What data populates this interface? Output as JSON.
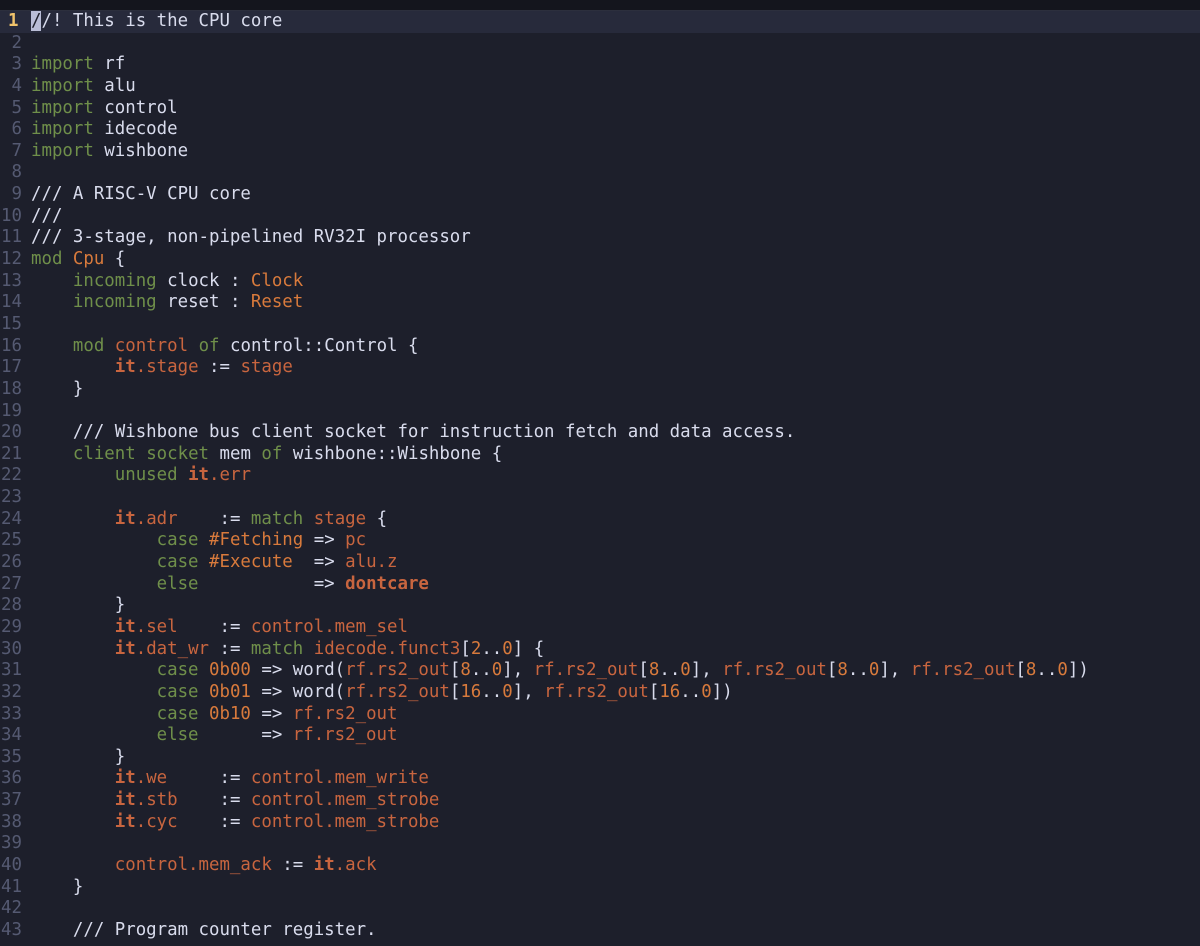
{
  "editor": {
    "current_line": 1,
    "lines": [
      [
        [
          "comment",
          "//! This is the CPU core"
        ]
      ],
      [],
      [
        [
          "keyword",
          "import"
        ],
        [
          "plain",
          " rf"
        ]
      ],
      [
        [
          "keyword",
          "import"
        ],
        [
          "plain",
          " alu"
        ]
      ],
      [
        [
          "keyword",
          "import"
        ],
        [
          "plain",
          " control"
        ]
      ],
      [
        [
          "keyword",
          "import"
        ],
        [
          "plain",
          " idecode"
        ]
      ],
      [
        [
          "keyword",
          "import"
        ],
        [
          "plain",
          " wishbone"
        ]
      ],
      [],
      [
        [
          "comment",
          "/// A RISC-V CPU core"
        ]
      ],
      [
        [
          "comment",
          "///"
        ]
      ],
      [
        [
          "comment",
          "/// 3-stage, non-pipelined RV32I processor"
        ]
      ],
      [
        [
          "keyword",
          "mod"
        ],
        [
          "plain",
          " "
        ],
        [
          "type",
          "Cpu"
        ],
        [
          "plain",
          " {"
        ]
      ],
      [
        [
          "plain",
          "    "
        ],
        [
          "keyword",
          "incoming"
        ],
        [
          "plain",
          " clock : "
        ],
        [
          "type",
          "Clock"
        ]
      ],
      [
        [
          "plain",
          "    "
        ],
        [
          "keyword",
          "incoming"
        ],
        [
          "plain",
          " reset : "
        ],
        [
          "type",
          "Reset"
        ]
      ],
      [],
      [
        [
          "plain",
          "    "
        ],
        [
          "keyword",
          "mod"
        ],
        [
          "plain",
          " "
        ],
        [
          "ident",
          "control"
        ],
        [
          "plain",
          " "
        ],
        [
          "keyword",
          "of"
        ],
        [
          "plain",
          " control::Control {"
        ]
      ],
      [
        [
          "plain",
          "        "
        ],
        [
          "bold",
          "it"
        ],
        [
          "ident",
          ".stage"
        ],
        [
          "plain",
          " := "
        ],
        [
          "ident",
          "stage"
        ]
      ],
      [
        [
          "plain",
          "    }"
        ]
      ],
      [],
      [
        [
          "plain",
          "    "
        ],
        [
          "comment",
          "/// Wishbone bus client socket for instruction fetch and data access."
        ]
      ],
      [
        [
          "plain",
          "    "
        ],
        [
          "keyword",
          "client"
        ],
        [
          "plain",
          " "
        ],
        [
          "keyword",
          "socket"
        ],
        [
          "plain",
          " mem "
        ],
        [
          "keyword",
          "of"
        ],
        [
          "plain",
          " wishbone::Wishbone {"
        ]
      ],
      [
        [
          "plain",
          "        "
        ],
        [
          "keyword",
          "unused"
        ],
        [
          "plain",
          " "
        ],
        [
          "bold",
          "it"
        ],
        [
          "ident",
          ".err"
        ]
      ],
      [],
      [
        [
          "plain",
          "        "
        ],
        [
          "bold",
          "it"
        ],
        [
          "ident",
          ".adr"
        ],
        [
          "plain",
          "    := "
        ],
        [
          "keyword",
          "match"
        ],
        [
          "plain",
          " "
        ],
        [
          "ident",
          "stage"
        ],
        [
          "plain",
          " {"
        ]
      ],
      [
        [
          "plain",
          "            "
        ],
        [
          "keyword",
          "case"
        ],
        [
          "plain",
          " "
        ],
        [
          "hash",
          "#Fetching"
        ],
        [
          "plain",
          " => "
        ],
        [
          "ident",
          "pc"
        ]
      ],
      [
        [
          "plain",
          "            "
        ],
        [
          "keyword",
          "case"
        ],
        [
          "plain",
          " "
        ],
        [
          "hash",
          "#Execute"
        ],
        [
          "plain",
          "  => "
        ],
        [
          "ident",
          "alu.z"
        ]
      ],
      [
        [
          "plain",
          "            "
        ],
        [
          "keyword",
          "else"
        ],
        [
          "plain",
          "           => "
        ],
        [
          "bold",
          "dontcare"
        ]
      ],
      [
        [
          "plain",
          "        }"
        ]
      ],
      [
        [
          "plain",
          "        "
        ],
        [
          "bold",
          "it"
        ],
        [
          "ident",
          ".sel"
        ],
        [
          "plain",
          "    := "
        ],
        [
          "ident",
          "control.mem_sel"
        ]
      ],
      [
        [
          "plain",
          "        "
        ],
        [
          "bold",
          "it"
        ],
        [
          "ident",
          ".dat_wr"
        ],
        [
          "plain",
          " := "
        ],
        [
          "keyword",
          "match"
        ],
        [
          "plain",
          " "
        ],
        [
          "ident",
          "idecode.funct3"
        ],
        [
          "plain",
          "["
        ],
        [
          "number",
          "2"
        ],
        [
          "plain",
          ".."
        ],
        [
          "number",
          "0"
        ],
        [
          "plain",
          "] {"
        ]
      ],
      [
        [
          "plain",
          "            "
        ],
        [
          "keyword",
          "case"
        ],
        [
          "plain",
          " "
        ],
        [
          "number",
          "0b00"
        ],
        [
          "plain",
          " => word("
        ],
        [
          "ident",
          "rf.rs2_out"
        ],
        [
          "plain",
          "["
        ],
        [
          "number",
          "8"
        ],
        [
          "plain",
          ".."
        ],
        [
          "number",
          "0"
        ],
        [
          "plain",
          "], "
        ],
        [
          "ident",
          "rf.rs2_out"
        ],
        [
          "plain",
          "["
        ],
        [
          "number",
          "8"
        ],
        [
          "plain",
          ".."
        ],
        [
          "number",
          "0"
        ],
        [
          "plain",
          "], "
        ],
        [
          "ident",
          "rf.rs2_out"
        ],
        [
          "plain",
          "["
        ],
        [
          "number",
          "8"
        ],
        [
          "plain",
          ".."
        ],
        [
          "number",
          "0"
        ],
        [
          "plain",
          "], "
        ],
        [
          "ident",
          "rf.rs2_out"
        ],
        [
          "plain",
          "["
        ],
        [
          "number",
          "8"
        ],
        [
          "plain",
          ".."
        ],
        [
          "number",
          "0"
        ],
        [
          "plain",
          "])"
        ]
      ],
      [
        [
          "plain",
          "            "
        ],
        [
          "keyword",
          "case"
        ],
        [
          "plain",
          " "
        ],
        [
          "number",
          "0b01"
        ],
        [
          "plain",
          " => word("
        ],
        [
          "ident",
          "rf.rs2_out"
        ],
        [
          "plain",
          "["
        ],
        [
          "number",
          "16"
        ],
        [
          "plain",
          ".."
        ],
        [
          "number",
          "0"
        ],
        [
          "plain",
          "], "
        ],
        [
          "ident",
          "rf.rs2_out"
        ],
        [
          "plain",
          "["
        ],
        [
          "number",
          "16"
        ],
        [
          "plain",
          ".."
        ],
        [
          "number",
          "0"
        ],
        [
          "plain",
          "])"
        ]
      ],
      [
        [
          "plain",
          "            "
        ],
        [
          "keyword",
          "case"
        ],
        [
          "plain",
          " "
        ],
        [
          "number",
          "0b10"
        ],
        [
          "plain",
          " => "
        ],
        [
          "ident",
          "rf.rs2_out"
        ]
      ],
      [
        [
          "plain",
          "            "
        ],
        [
          "keyword",
          "else"
        ],
        [
          "plain",
          "      => "
        ],
        [
          "ident",
          "rf.rs2_out"
        ]
      ],
      [
        [
          "plain",
          "        }"
        ]
      ],
      [
        [
          "plain",
          "        "
        ],
        [
          "bold",
          "it"
        ],
        [
          "ident",
          ".we"
        ],
        [
          "plain",
          "     := "
        ],
        [
          "ident",
          "control.mem_write"
        ]
      ],
      [
        [
          "plain",
          "        "
        ],
        [
          "bold",
          "it"
        ],
        [
          "ident",
          ".stb"
        ],
        [
          "plain",
          "    := "
        ],
        [
          "ident",
          "control.mem_strobe"
        ]
      ],
      [
        [
          "plain",
          "        "
        ],
        [
          "bold",
          "it"
        ],
        [
          "ident",
          ".cyc"
        ],
        [
          "plain",
          "    := "
        ],
        [
          "ident",
          "control.mem_strobe"
        ]
      ],
      [],
      [
        [
          "plain",
          "        "
        ],
        [
          "ident",
          "control.mem_ack"
        ],
        [
          "plain",
          " := "
        ],
        [
          "bold",
          "it"
        ],
        [
          "ident",
          ".ack"
        ]
      ],
      [
        [
          "plain",
          "    }"
        ]
      ],
      [],
      [
        [
          "plain",
          "    "
        ],
        [
          "comment",
          "/// Program counter register."
        ]
      ]
    ]
  }
}
